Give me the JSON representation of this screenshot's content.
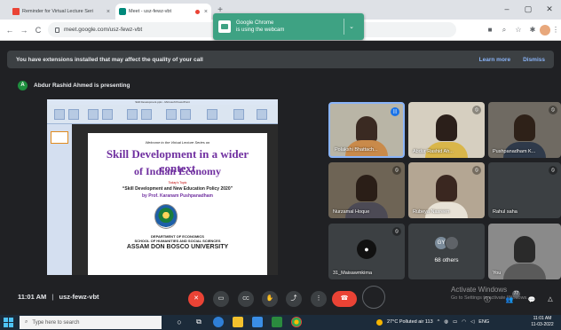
{
  "browser": {
    "tabs": [
      {
        "title": "Reminder for Virtual Lecture Seri",
        "favicon_color": "#ea4335"
      },
      {
        "title": "Meet - usz-fewz-vbt",
        "favicon_color": "#00897b"
      }
    ],
    "new_tab": "+",
    "window_controls": {
      "minimize": "–",
      "maximize": "▢",
      "close": "✕"
    },
    "url": "meet.google.com/usz-fewz-vbt",
    "nav": {
      "back": "←",
      "forward": "→",
      "reload": "C"
    }
  },
  "notification": {
    "line1": "Google Chrome",
    "line2": "is using the webcam",
    "chevron": "⌄"
  },
  "extension_banner": {
    "text": "You have extensions installed that may affect the quality of your call",
    "learn_more": "Learn more",
    "dismiss": "Dismiss"
  },
  "presenter": {
    "initial": "A",
    "text": "Abdur Rashid Ahmed is presenting"
  },
  "slide": {
    "app_title": "Skill Development.pptx - Microsoft PowerPoint",
    "intro": "Welcome to the Virtual Lecture Series on",
    "title_line1": "Skill Development in a wider context",
    "title_line2": "of Indian Economy",
    "topic_label": "Today's Topic",
    "topic": "“Skill Development and New Education Policy 2020”",
    "by": "by Prof. Karanam Pushpanadham",
    "dept": "DEPARTMENT OF ECONOMICS",
    "school": "SCHOOL OF HUMANITIES AND SOCIAL SCIENCES",
    "university": "ASSAM DON BOSCO UNIVERSITY"
  },
  "participants": [
    {
      "name": "Polakshi Bhattach...",
      "state": "speaking"
    },
    {
      "name": "Abdur Rashid Ah...",
      "state": "muted"
    },
    {
      "name": "Pushpanadham K...",
      "state": "muted"
    },
    {
      "name": "Nurzamal Hoque",
      "state": "muted"
    },
    {
      "name": "Rubeya Nasreen",
      "state": "muted"
    },
    {
      "name": "Rahul saha",
      "state": "muted"
    },
    {
      "name": "31_Maisawmkima",
      "state": "muted",
      "avatar": "●"
    },
    {
      "name": "68 others",
      "state": "group",
      "avatar_initials": "GY"
    },
    {
      "name": "You",
      "state": "self"
    }
  ],
  "bottom_bar": {
    "time": "11:01 AM",
    "meeting_code": "usz-fewz-vbt",
    "separator": "|",
    "controls": {
      "mic": "✕",
      "camera": "▭",
      "captions": "CC",
      "raise_hand": "✋",
      "present": "⤴",
      "more": "⋮",
      "leave": "☎"
    },
    "right": {
      "info": "ⓘ",
      "people": "👥",
      "people_count": "77",
      "chat": "💬",
      "activities": "△"
    }
  },
  "watermark": {
    "line1": "Activate Windows",
    "line2": "Go to Settings to activate Windows."
  },
  "taskbar": {
    "search_placeholder": "Type here to search",
    "weather": "27°C  Polluted air 113",
    "lang": "ENG",
    "time": "11:01 AM",
    "date": "11-03-2022"
  }
}
